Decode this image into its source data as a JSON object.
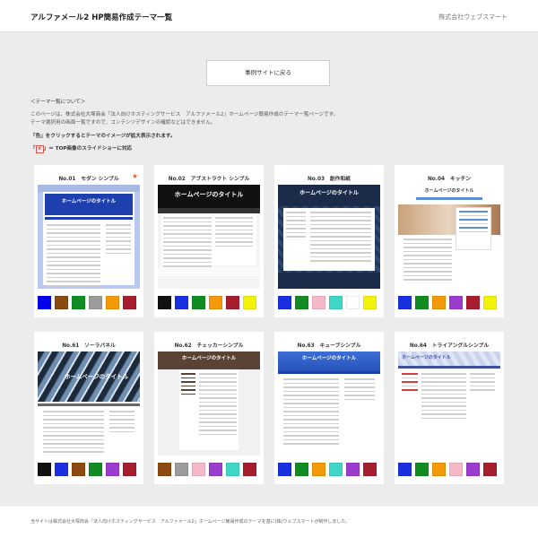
{
  "header": {
    "title": "アルファメール2 HP簡易作成テーマ一覧",
    "company": "株式会社ウェブスマート"
  },
  "back_button": "事例サイトに戻る",
  "about": {
    "heading": "＜テーマ一覧について＞",
    "line1": "このページは、株式会社大塚商会「法人向けホスティングサービス　アルファメール2」ホームページ簡易作成のテーマ一覧ページです。",
    "line2": "テーマ選択用の画面一覧ですので、コンテンツデザインの確認などはできません。",
    "line3": "「色」をクリックするとテーマのイメージが拡大表示されます。",
    "star_mark": "★",
    "line4_prefix": "「",
    "line4_suffix": "」＝ TOP画像のスライドショーに対応"
  },
  "thumb_title": "ホームページのタイトル",
  "themes": [
    {
      "no": "No.01　モダン シンプル",
      "star": "★",
      "colors": [
        "#0000ee",
        "#8a4a10",
        "#118c22",
        "#9b9b9b",
        "#f29a0a",
        "#a61d2e"
      ]
    },
    {
      "no": "No.02　アブストラクト シンプル",
      "star": "",
      "colors": [
        "#111111",
        "#1a2fe0",
        "#118c22",
        "#f29a0a",
        "#a61d2e",
        "#f2f20a"
      ]
    },
    {
      "no": "No.03　創作和紙",
      "star": "",
      "colors": [
        "#1a2fe0",
        "#118c22",
        "#f5b8c8",
        "#3fd6c8",
        "#ffffff",
        "#f2f20a"
      ]
    },
    {
      "no": "No.04　キッチン",
      "star": "",
      "colors": [
        "#1a2fe0",
        "#118c22",
        "#f29a0a",
        "#9b3ccf",
        "#a61d2e",
        "#f2f20a"
      ]
    },
    {
      "no": "No.61　ソーラパネル",
      "star": "",
      "colors": [
        "#111111",
        "#1a2fe0",
        "#8a4a10",
        "#118c22",
        "#9b3ccf",
        "#a61d2e"
      ]
    },
    {
      "no": "No.62　チェッカーシンプル",
      "star": "",
      "colors": [
        "#8a4a10",
        "#9b9b9b",
        "#f5b8c8",
        "#9b3ccf",
        "#3fd6c8",
        "#a61d2e"
      ]
    },
    {
      "no": "No.63　キューブシンプル",
      "star": "",
      "colors": [
        "#1a2fe0",
        "#118c22",
        "#f29a0a",
        "#3fd6c8",
        "#9b3ccf",
        "#a61d2e"
      ]
    },
    {
      "no": "No.64　トライアングルシンプル",
      "star": "",
      "colors": [
        "#1a2fe0",
        "#118c22",
        "#f29a0a",
        "#f5b8c8",
        "#9b3ccf",
        "#a61d2e"
      ]
    }
  ],
  "footer": "当サイトは株式会社大塚商会「法人向けホスティングサービス　アルファメール2」ホームページ簡易作成のテーマを基に(株)ウェブスマートが制作しました。"
}
